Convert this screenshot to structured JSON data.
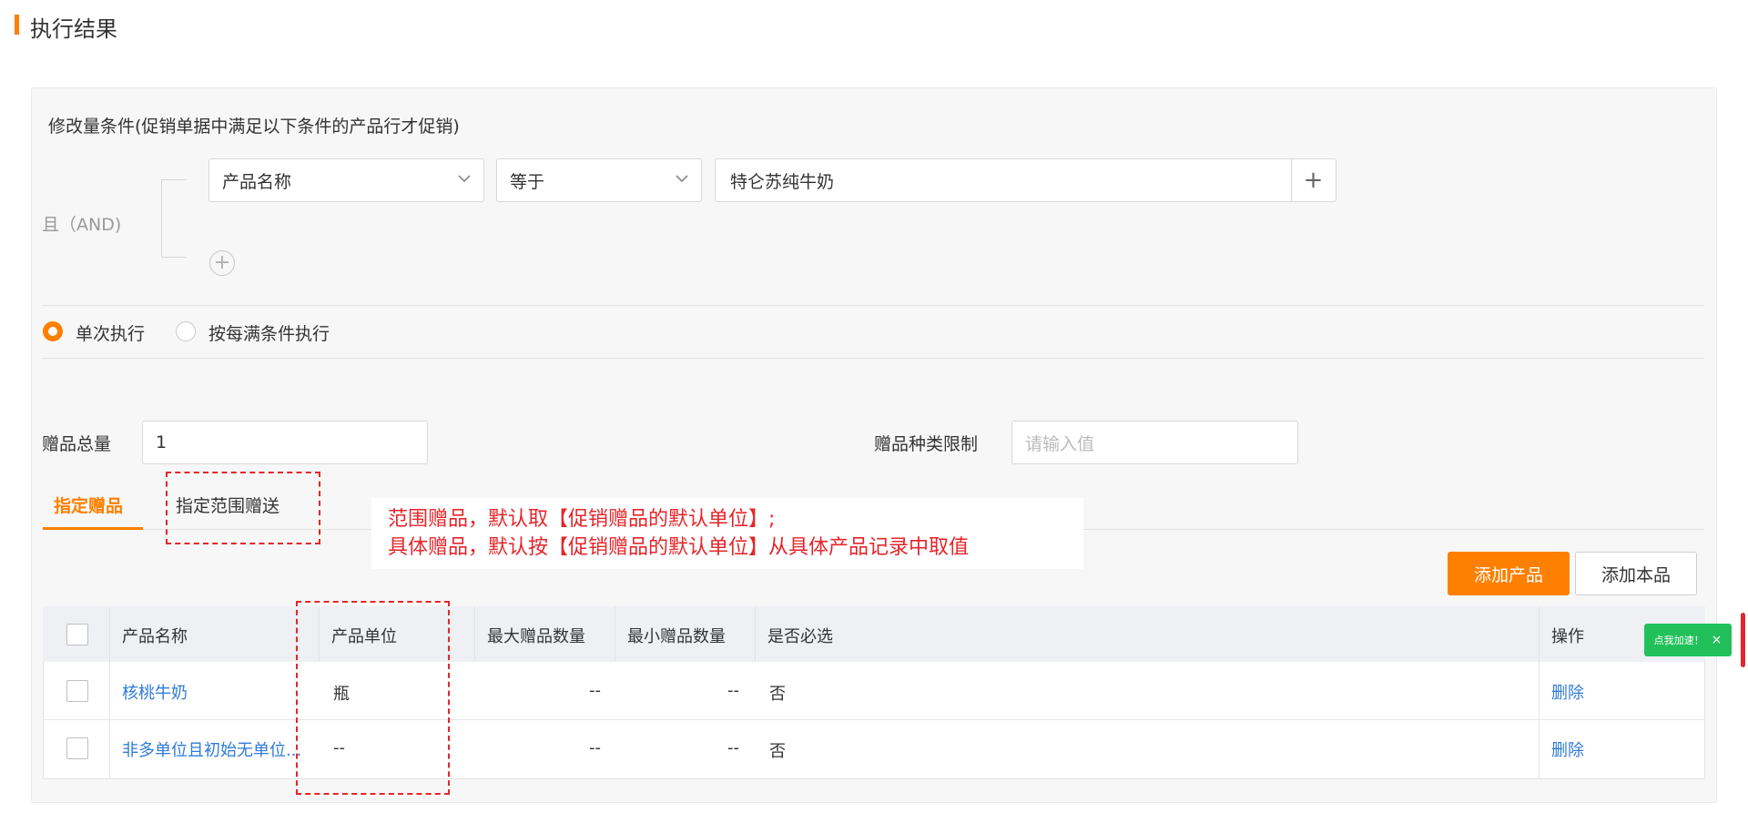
{
  "section": {
    "title": "执行结果"
  },
  "condition": {
    "title": "修改量条件(促销单据中满足以下条件的产品行才促销)",
    "logic_label": "且（AND)",
    "field_select": "产品名称",
    "operator_select": "等于",
    "value_input": "特仑苏纯牛奶",
    "add_symbol": "+",
    "add_circle_symbol": "+"
  },
  "execution": {
    "options": [
      {
        "label": "单次执行",
        "checked": true
      },
      {
        "label": "按每满条件执行",
        "checked": false
      }
    ]
  },
  "gift": {
    "total_label": "赠品总量",
    "total_value": "1",
    "kind_limit_label": "赠品种类限制",
    "kind_limit_placeholder": "请输入值"
  },
  "tabs": [
    {
      "label": "指定赠品",
      "active": true
    },
    {
      "label": "指定范围赠送",
      "active": false
    }
  ],
  "annotation": {
    "line1": "范围赠品，默认取【促销赠品的默认单位】;",
    "line2": "具体赠品，默认按【促销赠品的默认单位】从具体产品记录中取值"
  },
  "buttons": {
    "add_product": "添加产品",
    "add_self": "添加本品"
  },
  "table": {
    "headers": [
      "产品名称",
      "产品单位",
      "最大赠品数量",
      "最小赠品数量",
      "是否必选",
      "操作"
    ],
    "rows": [
      {
        "name": "核桃牛奶",
        "unit": "瓶",
        "max": "--",
        "min": "--",
        "required": "否",
        "action": "删除"
      },
      {
        "name": "非多单位且初始无单位...",
        "unit": "--",
        "max": "--",
        "min": "--",
        "required": "否",
        "action": "删除"
      }
    ]
  },
  "float_widget": {
    "label": "点我加速！",
    "close": "×"
  },
  "colors": {
    "accent": "#ff7f00",
    "link": "#2f7bd9",
    "annotation_red": "#e5252a",
    "badge_green": "#22c05a"
  }
}
